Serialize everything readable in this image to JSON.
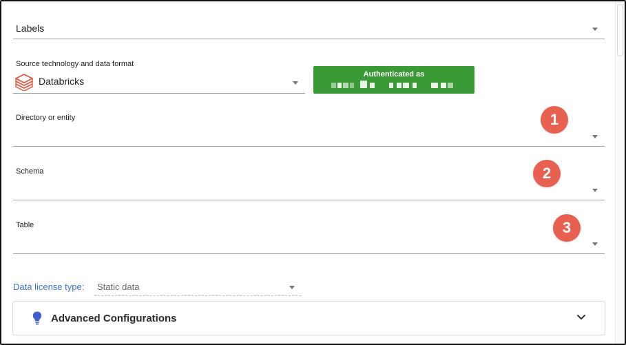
{
  "labels_field": {
    "value": "Labels"
  },
  "source_field": {
    "label": "Source technology and data format",
    "value": "Databricks",
    "icon": "databricks-icon"
  },
  "auth_badge": {
    "title": "Authenticated as",
    "color": "#3a9a35"
  },
  "directory_field": {
    "label": "Directory or entity"
  },
  "schema_field": {
    "label": "Schema"
  },
  "table_field": {
    "label": "Table"
  },
  "step_badges": [
    "1",
    "2",
    "3"
  ],
  "license": {
    "label": "Data license type:",
    "value": "Static data"
  },
  "advanced": {
    "title": "Advanced Configurations",
    "icon": "lightbulb-icon"
  },
  "colors": {
    "accent_blue": "#3b6fd1",
    "step_badge": "#e8604f",
    "auth_green": "#3a9a35",
    "databricks_red": "#e8533b"
  }
}
